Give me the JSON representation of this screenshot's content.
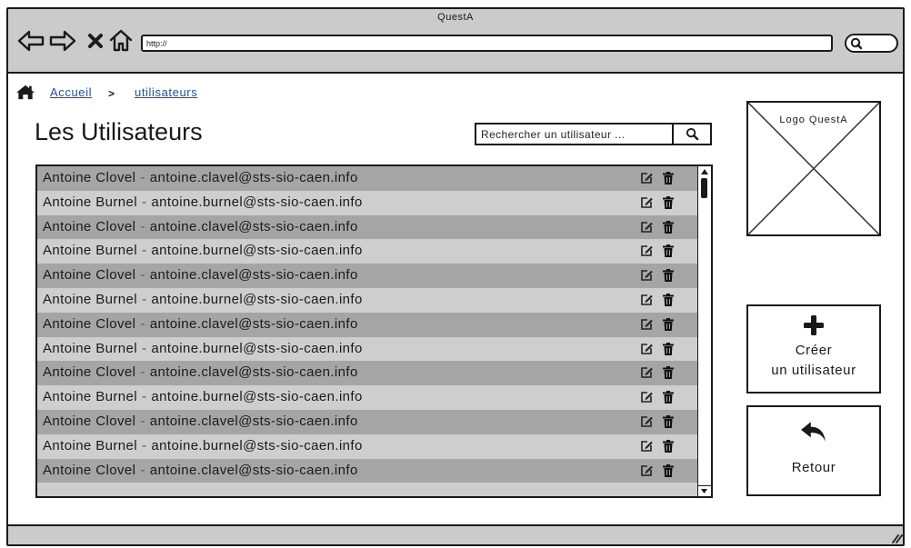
{
  "window": {
    "title": "QuestA"
  },
  "browser": {
    "url": "http://",
    "nav_icons": [
      "back-arrow-icon",
      "forward-arrow-icon",
      "stop-icon",
      "home-outline-icon"
    ],
    "search_icon": "search-icon"
  },
  "breadcrumb": {
    "home_icon": "home-icon",
    "home_label": "Accueil",
    "separator": ">",
    "current_label": "utilisateurs"
  },
  "page": {
    "title": "Les Utilisateurs"
  },
  "search": {
    "placeholder": "Rechercher un utilisateur ...",
    "button_icon": "search-icon"
  },
  "users": [
    {
      "name": "Antoine Clovel",
      "separator": "-",
      "email": "antoine.clavel@sts-sio-caen.info"
    },
    {
      "name": "Antoine Burnel",
      "separator": "-",
      "email": "antoine.burnel@sts-sio-caen.info"
    },
    {
      "name": "Antoine Clovel",
      "separator": "-",
      "email": "antoine.clavel@sts-sio-caen.info"
    },
    {
      "name": "Antoine Burnel",
      "separator": "-",
      "email": "antoine.burnel@sts-sio-caen.info"
    },
    {
      "name": "Antoine Clovel",
      "separator": "-",
      "email": "antoine.clavel@sts-sio-caen.info"
    },
    {
      "name": "Antoine Burnel",
      "separator": "-",
      "email": "antoine.burnel@sts-sio-caen.info"
    },
    {
      "name": "Antoine Clovel",
      "separator": "-",
      "email": "antoine.clavel@sts-sio-caen.info"
    },
    {
      "name": "Antoine Burnel",
      "separator": "-",
      "email": "antoine.burnel@sts-sio-caen.info"
    },
    {
      "name": "Antoine Clovel",
      "separator": "-",
      "email": "antoine.clavel@sts-sio-caen.info"
    },
    {
      "name": "Antoine Burnel",
      "separator": "-",
      "email": "antoine.burnel@sts-sio-caen.info"
    },
    {
      "name": "Antoine Clovel",
      "separator": "-",
      "email": "antoine.clavel@sts-sio-caen.info"
    },
    {
      "name": "Antoine Burnel",
      "separator": "-",
      "email": "antoine.burnel@sts-sio-caen.info"
    },
    {
      "name": "Antoine Clovel",
      "separator": "-",
      "email": "antoine.clavel@sts-sio-caen.info"
    }
  ],
  "row_actions": [
    "edit-icon",
    "trash-icon"
  ],
  "sidebar": {
    "logo_label": "Logo QuestA",
    "create_button": {
      "icon": "plus-icon",
      "line1": "Créer",
      "line2": "un utilisateur"
    },
    "back_button": {
      "icon": "reply-icon",
      "label": "Retour"
    }
  },
  "colors": {
    "chrome": "#cbcbcb",
    "row_dark": "#a5a5a5",
    "row_light": "#cecece",
    "link": "#1f4f99",
    "ink": "#1a1a1a"
  }
}
